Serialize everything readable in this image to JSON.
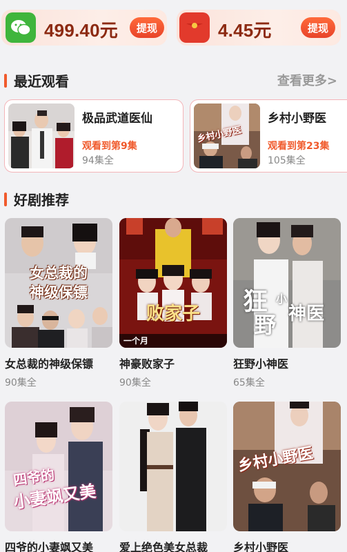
{
  "wallet": {
    "left": {
      "icon": "wechat-icon",
      "amount": "499.40元",
      "button": "提现"
    },
    "right": {
      "icon": "red-packet-icon",
      "amount": "4.45元",
      "button": "提现"
    }
  },
  "recent": {
    "title": "最近观看",
    "see_more": "查看更多>",
    "items": [
      {
        "title": "极品武道医仙",
        "progress": "观看到第9集",
        "total": "94集全"
      },
      {
        "title": "乡村小野医",
        "progress": "观看到第23集",
        "total": "105集全"
      }
    ]
  },
  "recommend": {
    "title": "好剧推荐",
    "items": [
      {
        "title": "女总裁的神级保镖",
        "eps": "90集全",
        "poster_text_1": "女总裁的",
        "poster_text_2": "神级保镖"
      },
      {
        "title": "神豪败家子",
        "eps": "90集全",
        "poster_text_1": "败家子",
        "poster_text_2": "一个月"
      },
      {
        "title": "狂野小神医",
        "eps": "65集全",
        "poster_text_1": "狂",
        "poster_text_2": "野",
        "poster_text_3": "小",
        "poster_text_4": "神医"
      },
      {
        "title": "四爷的小妻飒又美",
        "eps": "",
        "poster_text_1": "四爷的",
        "poster_text_2": "小妻飒又美"
      },
      {
        "title": "爱上绝色美女总裁",
        "eps": ""
      },
      {
        "title": "乡村小野医",
        "eps": "",
        "poster_text_1": "乡村小野医"
      }
    ]
  },
  "recent_thumb_texts": {
    "second": "乡村小野医"
  },
  "colors": {
    "accent": "#f05a2c",
    "amount": "#8c2a12",
    "wechat": "#3fb53c",
    "red_packet": "#e23a2c"
  }
}
